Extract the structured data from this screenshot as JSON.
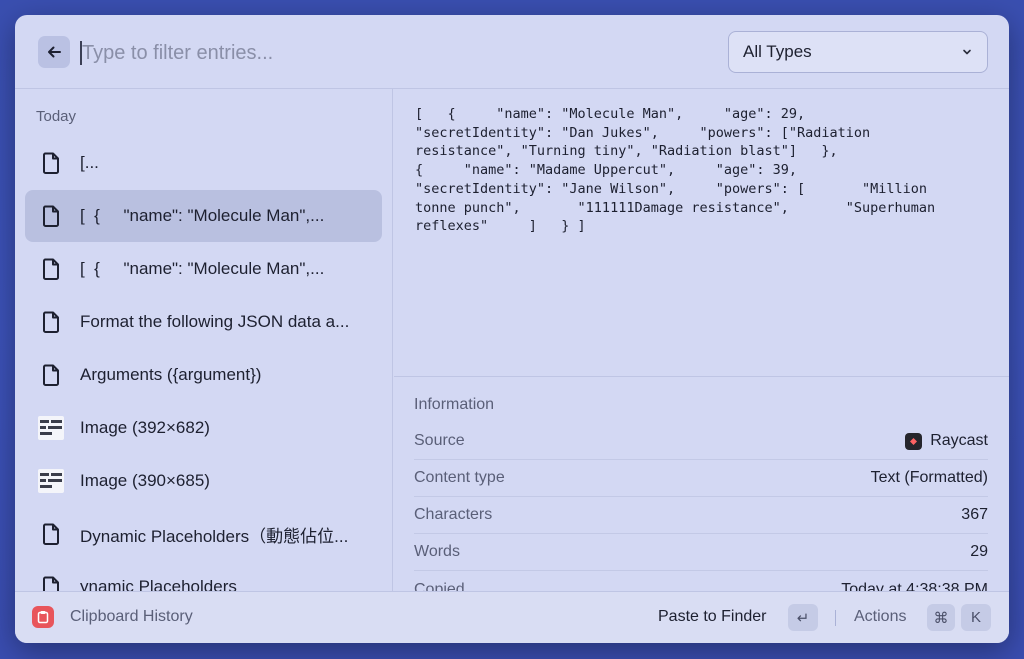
{
  "header": {
    "search_placeholder": "Type to filter entries...",
    "search_value": "",
    "type_filter": "All Types"
  },
  "sidebar": {
    "section_title": "Today",
    "items": [
      {
        "label": "[...",
        "icon": "document-icon"
      },
      {
        "label": "[  {     \"name\": \"Molecule Man\",...",
        "icon": "document-icon"
      },
      {
        "label": "[  {     \"name\": \"Molecule Man\",...",
        "icon": "document-icon"
      },
      {
        "label": "Format the following JSON data a...",
        "icon": "document-icon"
      },
      {
        "label": "Arguments ({argument})",
        "icon": "document-icon"
      },
      {
        "label": "Image (392×682)",
        "icon": "image-thumbnail"
      },
      {
        "label": "Image (390×685)",
        "icon": "image-thumbnail"
      },
      {
        "label": "Dynamic Placeholders（動態佔位...",
        "icon": "document-icon"
      },
      {
        "label": "ynamic Placeholders",
        "icon": "document-icon"
      }
    ],
    "selected_index": 1
  },
  "detail": {
    "content": "[   {     \"name\": \"Molecule Man\",     \"age\": 29,\n\"secretIdentity\": \"Dan Jukes\",     \"powers\": [\"Radiation\nresistance\", \"Turning tiny\", \"Radiation blast\"]   },\n{     \"name\": \"Madame Uppercut\",     \"age\": 39,\n\"secretIdentity\": \"Jane Wilson\",     \"powers\": [       \"Million\ntonne punch\",       \"111111Damage resistance\",       \"Superhuman\nreflexes\"     ]   } ]",
    "information": {
      "title": "Information",
      "rows": [
        {
          "key": "Source",
          "value": "Raycast",
          "icon": "raycast-icon"
        },
        {
          "key": "Content type",
          "value": "Text (Formatted)"
        },
        {
          "key": "Characters",
          "value": "367"
        },
        {
          "key": "Words",
          "value": "29"
        },
        {
          "key": "Copied",
          "value": "Today at 4:38:38 PM"
        }
      ]
    }
  },
  "footer": {
    "app_title": "Clipboard History",
    "primary_action": "Paste to Finder",
    "primary_shortcut": "↵",
    "actions_label": "Actions",
    "actions_shortcut": [
      "⌘",
      "K"
    ]
  },
  "colors": {
    "background": "#3a4fb0",
    "window": "#d3d8f3",
    "selected": "#b9c0e0",
    "app_icon": "#e8555b"
  }
}
